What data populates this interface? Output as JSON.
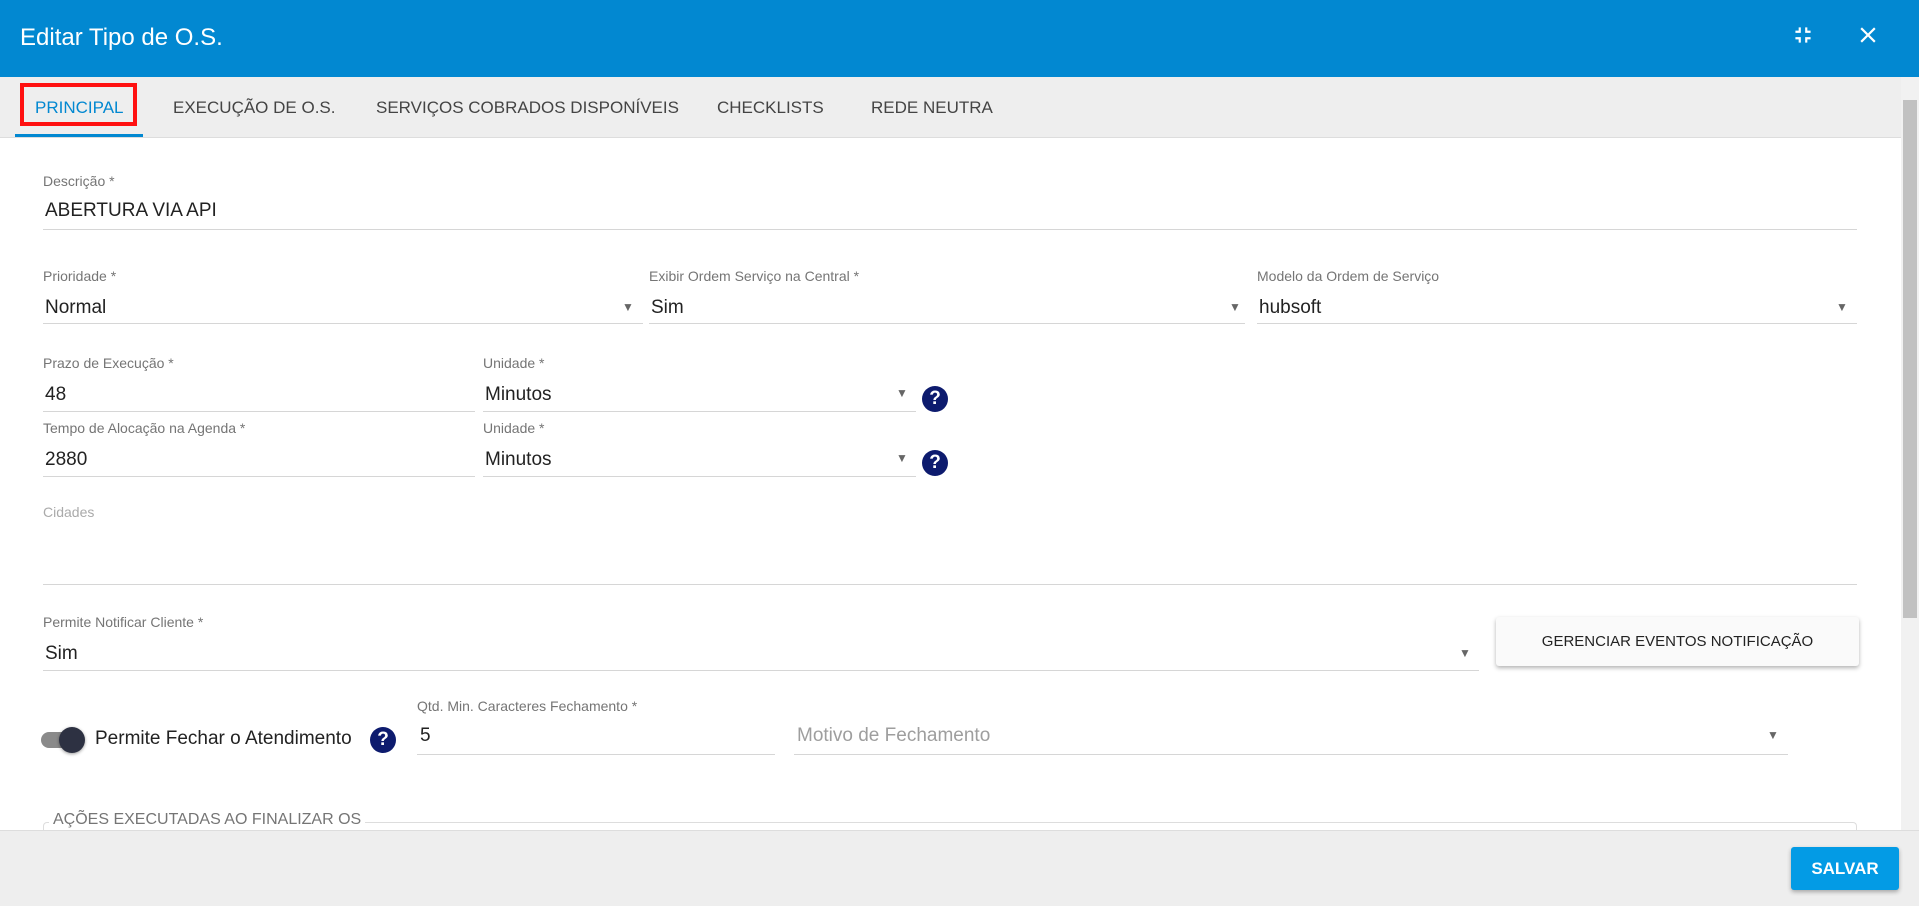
{
  "header": {
    "title": "Editar Tipo de O.S.",
    "minimize_icon": "compress-icon",
    "close_icon": "close-icon"
  },
  "tabs": [
    {
      "label": "PRINCIPAL",
      "active": true
    },
    {
      "label": "EXECUÇÃO DE O.S."
    },
    {
      "label": "SERVIÇOS COBRADOS DISPONÍVEIS"
    },
    {
      "label": "CHECKLISTS"
    },
    {
      "label": "REDE NEUTRA"
    }
  ],
  "form": {
    "descricao": {
      "label": "Descrição *",
      "value": "ABERTURA VIA API"
    },
    "prioridade": {
      "label": "Prioridade *",
      "value": "Normal"
    },
    "exibir": {
      "label": "Exibir Ordem Serviço na Central *",
      "value": "Sim"
    },
    "modelo": {
      "label": "Modelo da Ordem de Serviço",
      "value": "hubsoft"
    },
    "prazo": {
      "label": "Prazo de Execução *",
      "value": "48"
    },
    "unidade1": {
      "label": "Unidade *",
      "value": "Minutos"
    },
    "tempo": {
      "label": "Tempo de Alocação na Agenda *",
      "value": "2880"
    },
    "unidade2": {
      "label": "Unidade *",
      "value": "Minutos"
    },
    "cidades": {
      "label": "Cidades"
    },
    "notificar": {
      "label": "Permite Notificar Cliente *",
      "value": "Sim"
    },
    "gerenciar_button": "GERENCIAR EVENTOS NOTIFICAÇÃO",
    "fechar_toggle": {
      "label": "Permite Fechar o Atendimento",
      "on": true
    },
    "qtd": {
      "label": "Qtd. Min. Caracteres Fechamento *",
      "value": "5"
    },
    "motivo": {
      "placeholder": "Motivo de Fechamento"
    },
    "acoes_legend": "AÇÕES EXECUTADAS AO FINALIZAR OS"
  },
  "footer": {
    "save_label": "SALVAR"
  },
  "colors": {
    "primary": "#0288d1",
    "highlight": "#ff1010",
    "help": "#0d1b6e"
  }
}
